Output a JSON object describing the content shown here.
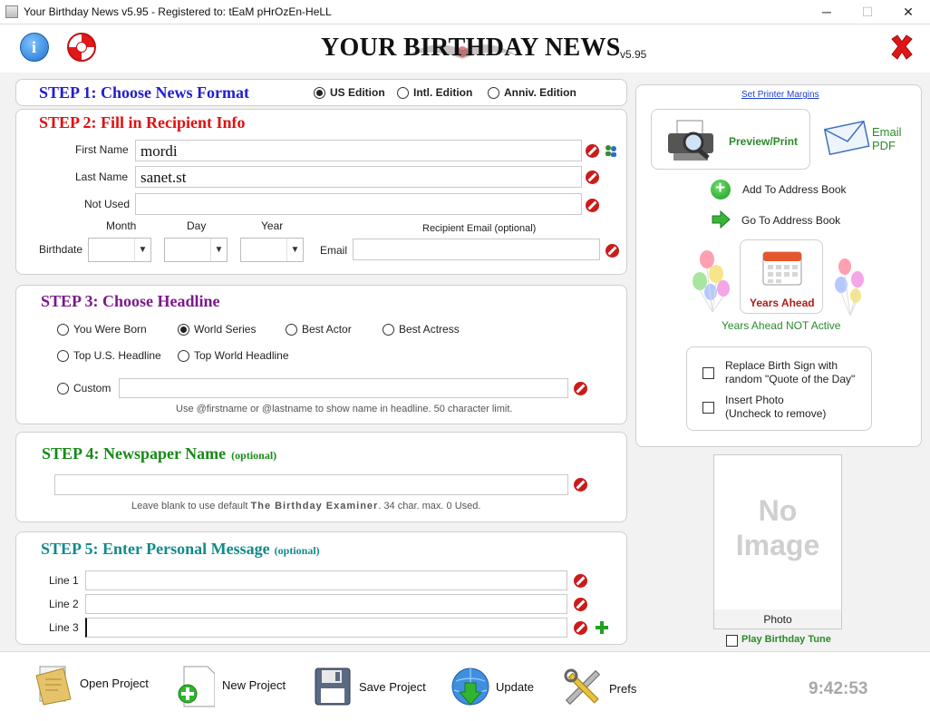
{
  "window": {
    "title": "Your Birthday News v5.95 - Registered to: tEaM pHrOzEn-HeLL",
    "minimize": "─",
    "maximize": "☐",
    "close": "✕"
  },
  "header": {
    "app_title": "YOUR BIRTHDAY NEWS",
    "version": "v5.95",
    "info_icon": "info-icon",
    "help_icon": "lifebuoy-icon",
    "exit_icon": "red-x-icon"
  },
  "step1": {
    "title": "STEP 1: Choose News Format",
    "options": [
      {
        "label": "US Edition",
        "selected": true
      },
      {
        "label": "Intl. Edition",
        "selected": false
      },
      {
        "label": "Anniv. Edition",
        "selected": false
      }
    ]
  },
  "step2": {
    "title": "STEP 2: Fill in Recipient Info",
    "first_name_label": "First Name",
    "first_name_value": "mordi",
    "last_name_label": "Last Name",
    "last_name_value": "sanet.st",
    "not_used_label": "Not Used",
    "not_used_value": "",
    "month_label": "Month",
    "day_label": "Day",
    "year_label": "Year",
    "birthdate_label": "Birthdate",
    "email_header": "Recipient Email (optional)",
    "email_label": "Email",
    "email_value": ""
  },
  "step3": {
    "title": "STEP 3: Choose Headline",
    "options": [
      {
        "label": "You Were Born",
        "selected": false
      },
      {
        "label": "World Series",
        "selected": true
      },
      {
        "label": "Best Actor",
        "selected": false
      },
      {
        "label": "Best Actress",
        "selected": false
      },
      {
        "label": "Top U.S. Headline",
        "selected": false
      },
      {
        "label": "Top World Headline",
        "selected": false
      },
      {
        "label": "Custom",
        "selected": false
      }
    ],
    "custom_value": "",
    "hint": "Use @firstname or @lastname to show name in headline. 50 character limit."
  },
  "step4": {
    "title": "STEP 4: Newspaper Name",
    "optional": "(optional)",
    "value": "",
    "hint_prefix": "Leave blank to use default",
    "hint_name": "The Birthday Examiner",
    "hint_suffix": ". 34 char. max. 0 Used."
  },
  "step5": {
    "title": "STEP 5: Enter Personal Message",
    "optional": "(optional)",
    "lines": [
      {
        "label": "Line 1",
        "value": ""
      },
      {
        "label": "Line 2",
        "value": ""
      },
      {
        "label": "Line 3",
        "value": ""
      }
    ]
  },
  "right": {
    "printer_margins": "Set Printer Margins",
    "preview_print": "Preview/Print",
    "email_pdf_line1": "Email",
    "email_pdf_line2": "PDF",
    "add_to_address_book": "Add To Address Book",
    "go_to_address_book": "Go To Address Book",
    "years_ahead": "Years Ahead",
    "years_ahead_status": "Years Ahead NOT Active",
    "replace_birth_sign_line1": "Replace Birth Sign with",
    "replace_birth_sign_line2": "random \"Quote of the Day\"",
    "insert_photo_line1": "Insert Photo",
    "insert_photo_line2": "(Uncheck to remove)",
    "photo_placeholder_line1": "No",
    "photo_placeholder_line2": "Image",
    "photo_label": "Photo",
    "play_birthday_tune": "Play Birthday Tune"
  },
  "toolbar": {
    "open_project": "Open Project",
    "new_project": "New Project",
    "save_project": "Save Project",
    "update": "Update",
    "prefs": "Prefs",
    "clock": "9:42:53"
  },
  "colors": {
    "step1": "#1f1fd0",
    "step2": "#e01010",
    "step3": "#7a1a8a",
    "step4": "#178a17",
    "step5": "#138a8a",
    "green_text": "#2a8a2a"
  }
}
